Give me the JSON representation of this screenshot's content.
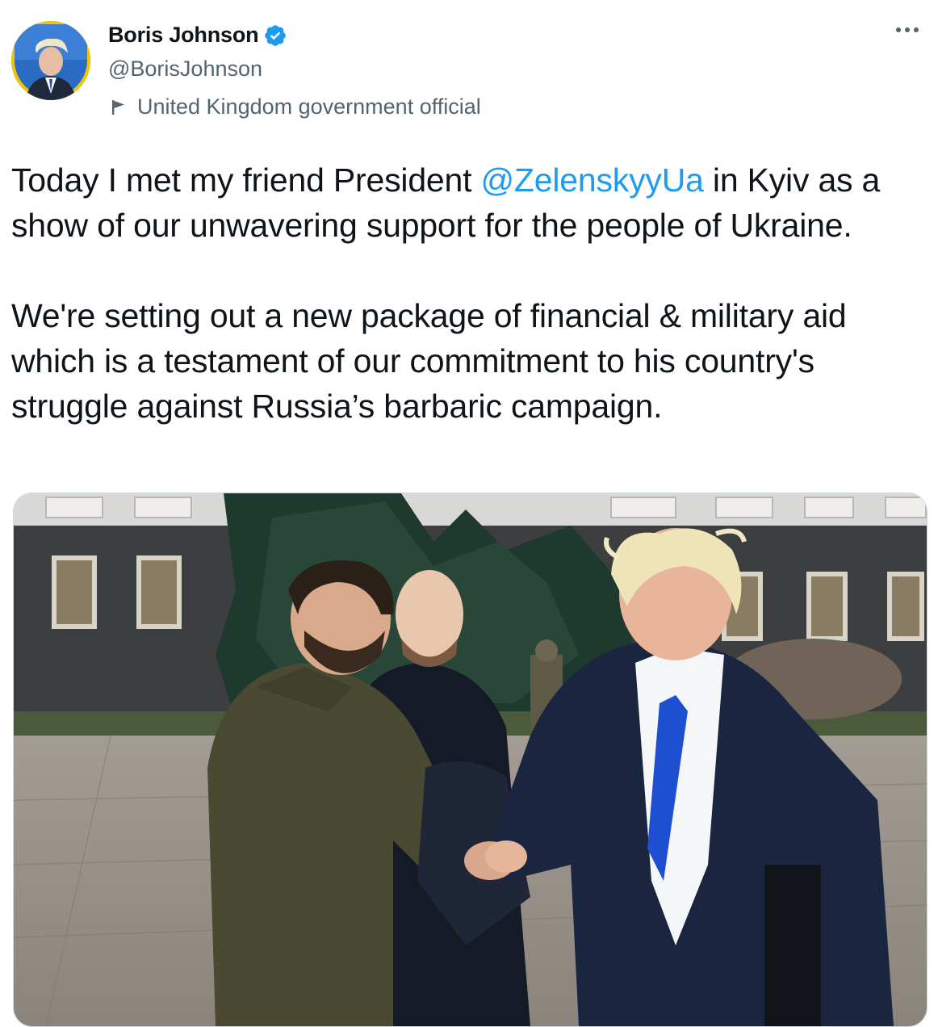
{
  "author": {
    "display_name": "Boris Johnson",
    "handle": "@BorisJohnson",
    "verified": true,
    "label": "United Kingdom government official",
    "avatar_icon": "profile-photo"
  },
  "more_icon": "more-horizontal-icon",
  "tweet": {
    "para1_before": "Today I met my friend President ",
    "mention": "@ZelenskyyUa",
    "para1_after": " in Kyiv as a show of our unwavering support for the people of Ukraine.",
    "para2": "We're setting out a new package of financial & military aid which is a testament of our commitment to his country's struggle against Russia’s barbaric campaign."
  },
  "media": {
    "type": "photo"
  },
  "colors": {
    "link": "#1d9bf0",
    "secondary_text": "#536471",
    "verified_badge": "#1d9bf0",
    "avatar_ring": "#f0c400"
  }
}
